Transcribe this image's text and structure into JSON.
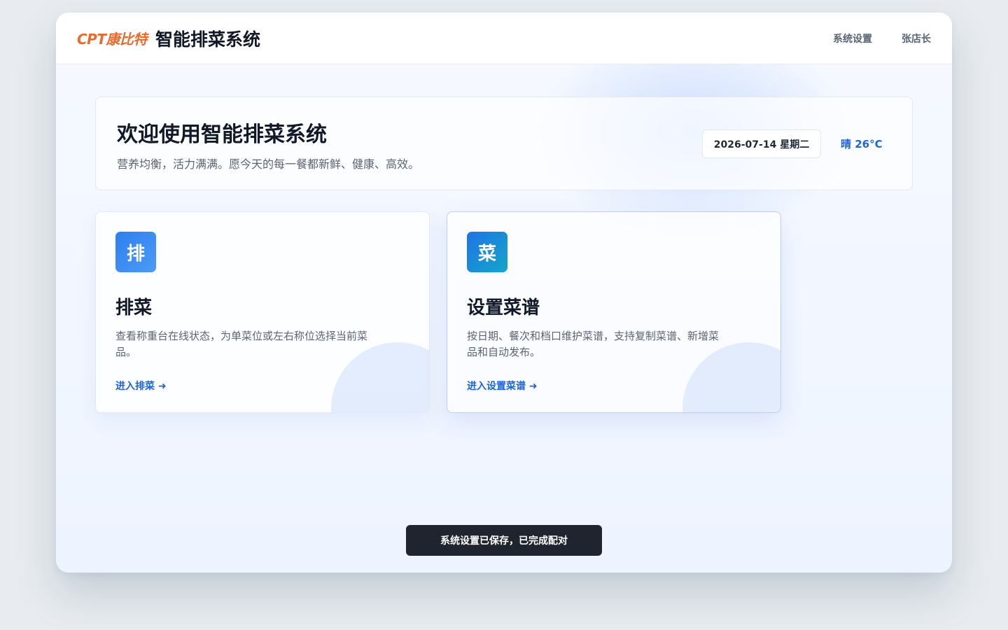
{
  "header": {
    "logo_text": "CPT康比特",
    "title": "智能排菜系统",
    "nav": [
      {
        "label": "系统设置"
      },
      {
        "label": "张店长"
      }
    ]
  },
  "welcome": {
    "title": "欢迎使用智能排菜系统",
    "subtitle": "营养均衡，活力满满。愿今天的每一餐都新鲜、健康、高效。",
    "date": "2026-07-14 星期二",
    "weather": "晴 26°C"
  },
  "cards": [
    {
      "badge": "排",
      "title": "排菜",
      "description": "查看称重台在线状态，为单菜位或左右称位选择当前菜品。",
      "link": "进入排菜 ➜"
    },
    {
      "badge": "菜",
      "title": "设置菜谱",
      "description": "按日期、餐次和档口维护菜谱，支持复制菜谱、新增菜品和自动发布。",
      "link": "进入设置菜谱 ➜"
    }
  ],
  "toast": {
    "message": "系统设置已保存，已完成配对"
  },
  "colors": {
    "accent": "#1f63d6",
    "logo": "#ea6a2c",
    "toast_bg": "#20242e"
  }
}
